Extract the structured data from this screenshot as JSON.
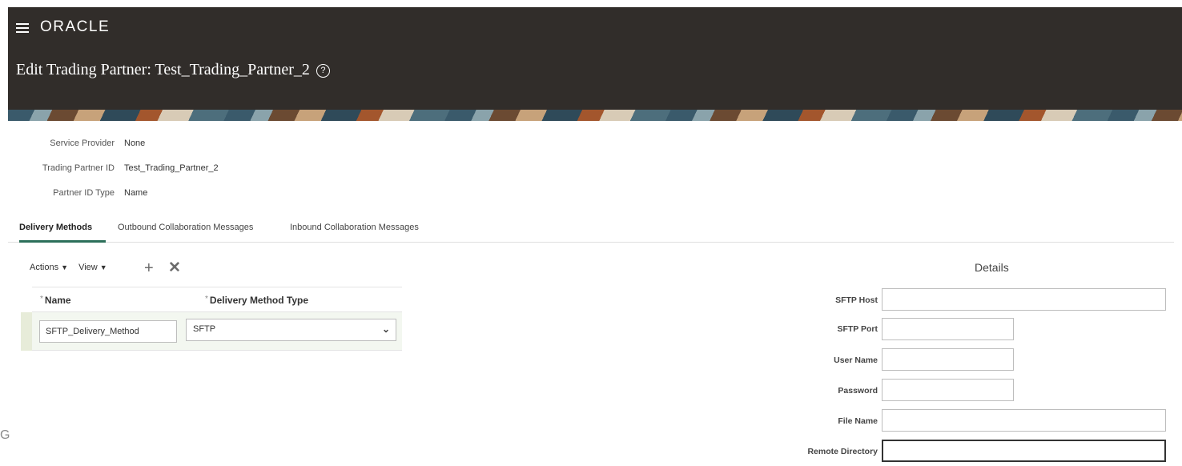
{
  "header": {
    "logo": "ORACLE",
    "title": "Edit Trading Partner: Test_Trading_Partner_2",
    "help_symbol": "?"
  },
  "info": {
    "service_provider_label": "Service Provider",
    "service_provider_value": "None",
    "tp_id_label": "Trading Partner ID",
    "tp_id_value": "Test_Trading_Partner_2",
    "id_type_label": "Partner ID Type",
    "id_type_value": "Name"
  },
  "tabs": [
    {
      "label": "Delivery Methods",
      "active": true
    },
    {
      "label": "Outbound Collaboration Messages",
      "active": false
    },
    {
      "label": "Inbound Collaboration Messages",
      "active": false
    }
  ],
  "toolbar": {
    "actions_label": "Actions",
    "view_label": "View"
  },
  "grid": {
    "columns": [
      "Name",
      "Delivery Method Type"
    ],
    "required_mark": "*",
    "row": {
      "name": "SFTP_Delivery_Method",
      "type": "SFTP"
    }
  },
  "details": {
    "title": "Details",
    "fields": [
      {
        "label": "SFTP Host",
        "value": ""
      },
      {
        "label": "SFTP Port",
        "value": ""
      },
      {
        "label": "User Name",
        "value": ""
      },
      {
        "label": "Password",
        "value": ""
      },
      {
        "label": "File Name",
        "value": ""
      },
      {
        "label": "Remote Directory",
        "value": ""
      }
    ]
  },
  "stray_text": "G",
  "colors": {
    "header_bg": "#312d2a",
    "active_tab_underline": "#2c6f5a"
  }
}
